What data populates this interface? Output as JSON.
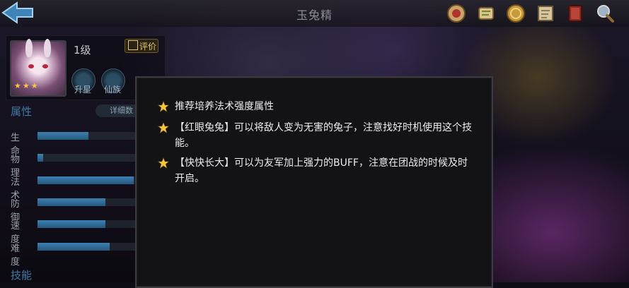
{
  "header": {
    "title": "玉兔精"
  },
  "hero": {
    "level": "1级",
    "rate_label": "评价",
    "upgrade_label": "升星",
    "fairy_label": "仙族"
  },
  "attributes": {
    "section_title": "属性",
    "detail_label": "详细数",
    "stats": [
      {
        "label": "生命",
        "fill": 0.45
      },
      {
        "label": "物理",
        "fill": 0.05
      },
      {
        "label": "法术",
        "fill": 0.85
      },
      {
        "label": "防御",
        "fill": 0.6
      },
      {
        "label": "速度",
        "fill": 0.6
      },
      {
        "label": "难度",
        "fill": 0.64
      }
    ]
  },
  "skills": {
    "section_title": "技能"
  },
  "dialog": {
    "tips": [
      "推荐培养法术强度属性",
      "【红眼兔兔】可以将敌人变为无害的兔子，注意找好时机使用这个技能。",
      "【快快长大】可以为友军加上强力的BUFF，注意在团战的时候及时开启。"
    ]
  },
  "colors": {
    "accent": "#3f7ba8",
    "star": "#f5c542",
    "bar": "#3d7fb0"
  },
  "icons": [
    "back-arrow-icon",
    "scroll-seal-icon",
    "scroll-icon",
    "coin-icon",
    "map-icon",
    "book-icon",
    "magnifier-icon",
    "star-icon"
  ]
}
